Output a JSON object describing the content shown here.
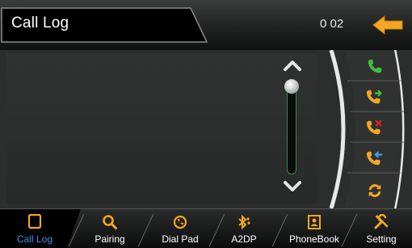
{
  "header": {
    "title": "Call Log",
    "counter": "0 02",
    "back_icon": "back-arrow-icon",
    "accent": "#f5a623"
  },
  "list": {
    "items": []
  },
  "scrollbar": {
    "up_icon": "chevron-up-icon",
    "down_icon": "chevron-down-icon",
    "position": 0
  },
  "side_actions": [
    {
      "name": "dialed-calls",
      "icon": "phone-icon",
      "color": "#3fbf3f"
    },
    {
      "name": "outgoing-calls",
      "icon": "phone-outgoing-icon",
      "color": "#f5a623"
    },
    {
      "name": "missed-calls",
      "icon": "phone-missed-icon",
      "color": "#f5a623"
    },
    {
      "name": "received-calls",
      "icon": "phone-incoming-icon",
      "color": "#f5a623"
    },
    {
      "name": "sync",
      "icon": "sync-icon",
      "color": "#f5a623"
    }
  ],
  "tabs": [
    {
      "label": "Call Log",
      "icon": "phone-book-outline-icon",
      "active": true
    },
    {
      "label": "Pairing",
      "icon": "search-icon",
      "active": false
    },
    {
      "label": "Dial Pad",
      "icon": "dial-icon",
      "active": false
    },
    {
      "label": "A2DP",
      "icon": "bluetooth-music-icon",
      "active": false
    },
    {
      "label": "PhoneBook",
      "icon": "contacts-icon",
      "active": false
    },
    {
      "label": "Setting",
      "icon": "tools-icon",
      "active": false
    }
  ],
  "colors": {
    "active_tab_text": "#3d8fe8",
    "icon_orange": "#f5a623",
    "icon_green": "#3fbf3f"
  }
}
